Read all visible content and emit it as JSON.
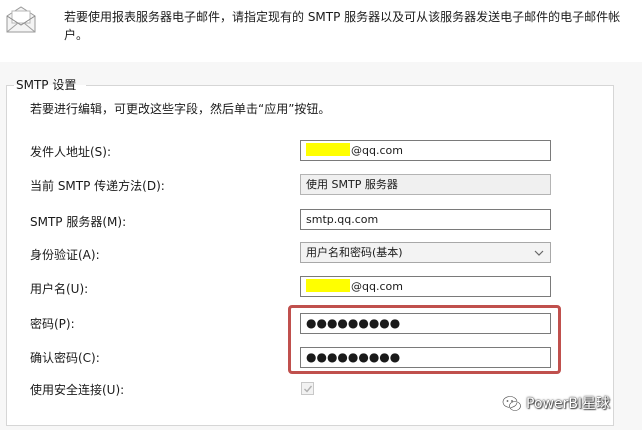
{
  "header": {
    "icon": "mail-icon",
    "description": "若要使用报表服务器电子邮件，请指定现有的 SMTP 服务器以及可从该服务器发送电子邮件的电子邮件帐户。"
  },
  "smtp_settings": {
    "group_title": "SMTP 设置",
    "hint": "若要进行编辑，可更改这些字段，然后单击“应用”按钮。",
    "fields": {
      "sender": {
        "label": "发件人地址(S):",
        "value_suffix": "@qq.com"
      },
      "delivery_method": {
        "label": "当前 SMTP 传递方法(D):",
        "value": "使用 SMTP 服务器"
      },
      "smtp_server": {
        "label": "SMTP 服务器(M):",
        "value": "smtp.qq.com"
      },
      "authentication": {
        "label": "身份验证(A):",
        "value": "用户名和密码(基本)"
      },
      "username": {
        "label": "用户名(U):",
        "value_suffix": "@qq.com"
      },
      "password": {
        "label": "密码(P):",
        "value": "●●●●●●●●●"
      },
      "confirm_password": {
        "label": "确认密码(C):",
        "value": "●●●●●●●●●"
      },
      "secure_connection": {
        "label": "使用安全连接(U):",
        "checked": true
      }
    }
  },
  "watermark": {
    "text": "PowerBI星球",
    "icon": "wechat-icon"
  },
  "colors": {
    "highlight": "#ffff00",
    "annotation_frame": "#c0504d"
  }
}
